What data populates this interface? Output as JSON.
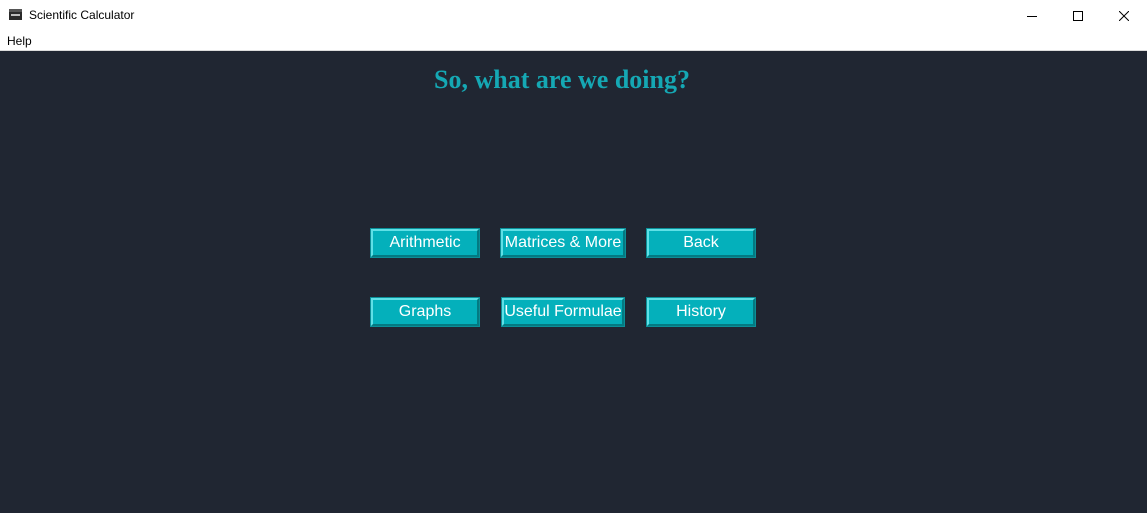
{
  "window": {
    "title": "Scientific Calculator",
    "icon": "calculator-app-icon",
    "controls": [
      "minimize-icon",
      "maximize-icon",
      "close-icon"
    ]
  },
  "menubar": {
    "items": [
      {
        "label": "Help"
      }
    ]
  },
  "main": {
    "heading": "So, what are we doing?",
    "buttons": [
      {
        "label": "Arithmetic"
      },
      {
        "label": "Matrices & More"
      },
      {
        "label": "Back"
      },
      {
        "label": "Graphs"
      },
      {
        "label": "Useful Formulae"
      },
      {
        "label": "History"
      }
    ]
  },
  "colors": {
    "background": "#202632",
    "heading": "#15a8b4",
    "button": "#04b0bb",
    "button_text": "#ffffff"
  }
}
